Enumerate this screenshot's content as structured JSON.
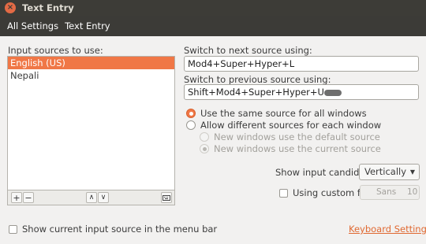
{
  "window": {
    "title": "Text Entry"
  },
  "toolbar": {
    "all_settings": "All Settings",
    "current": "Text Entry"
  },
  "sources": {
    "label": "Input sources to use:",
    "items": [
      {
        "label": "English (US)",
        "selected": true
      },
      {
        "label": "Nepali",
        "selected": false
      }
    ],
    "add": "+",
    "remove": "−",
    "up": "∧",
    "down": "∨"
  },
  "next_source": {
    "label": "Switch to next source using:",
    "value": "Mod4+Super+Hyper+L"
  },
  "prev_source": {
    "label": "Switch to previous source using:",
    "value": "Shift+Mod4+Super+Hyper+U"
  },
  "source_mode": {
    "same": "Use the same source for all windows",
    "different": "Allow different sources for each window",
    "new_default": "New windows use the default source",
    "new_current": "New windows use the current source"
  },
  "candidates": {
    "label": "Show input candidates:",
    "value": "Vertically"
  },
  "custom_font": {
    "label": "Using custom font:",
    "font_name": "Sans",
    "font_size": "10"
  },
  "footer": {
    "show_in_menu": "Show current input source in the menu bar",
    "keyboard_settings": "Keyboard Settings..."
  },
  "colors": {
    "accent": "#f07746",
    "titlebar": "#3d3c37",
    "link": "#e06932"
  }
}
